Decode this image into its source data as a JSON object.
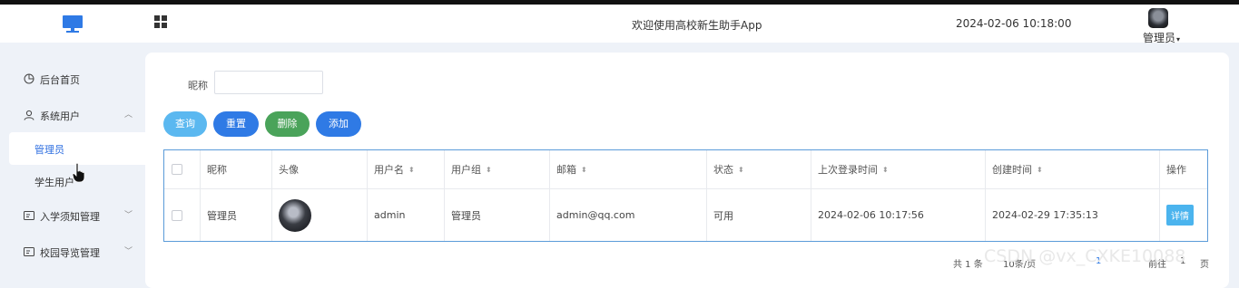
{
  "header": {
    "app_title": "欢迎使用高校新生助手App",
    "datetime": "2024-02-06 10:18:00",
    "user_menu": "管理员"
  },
  "sidebar": {
    "items": [
      {
        "label": "后台首页",
        "icon": "pie-chart-icon"
      },
      {
        "label": "系统用户",
        "icon": "user-icon",
        "expanded": true
      },
      {
        "label": "入学须知管理",
        "icon": "card-icon"
      },
      {
        "label": "校园导览管理",
        "icon": "card-icon"
      }
    ],
    "subitems": [
      {
        "label": "管理员",
        "active": true
      },
      {
        "label": "学生用户",
        "active": false
      }
    ]
  },
  "search": {
    "label": "昵称",
    "value": ""
  },
  "buttons": {
    "query": "查询",
    "reset": "重置",
    "delete": "删除",
    "add": "添加"
  },
  "table": {
    "columns": [
      "昵称",
      "头像",
      "用户名",
      "用户组",
      "邮箱",
      "状态",
      "上次登录时间",
      "创建时间",
      "操作"
    ],
    "rows": [
      {
        "nickname": "管理员",
        "username": "admin",
        "group": "管理员",
        "email": "admin@qq.com",
        "status": "可用",
        "last_login": "2024-02-06 10:17:56",
        "created": "2024-02-29 17:35:13",
        "action": "详情"
      }
    ]
  },
  "pagination": {
    "total": "共 1 条",
    "page_size": "10条/页",
    "current_page": "1",
    "goto": "前往",
    "goto_value": "1",
    "page_unit": "页"
  },
  "watermark": "CSDN @vx_CXKE10088",
  "colors": {
    "accent": "#2f7ae5",
    "query": "#5bb8f0",
    "delete": "#4aa35a",
    "detail": "#4bb4ee"
  }
}
